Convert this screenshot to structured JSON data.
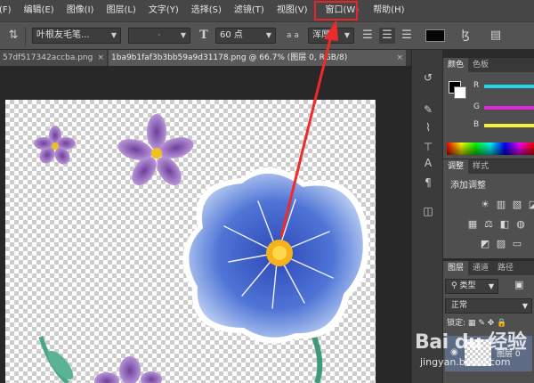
{
  "menubar": {
    "items": [
      "(F)",
      "编辑(E)",
      "图像(I)",
      "图层(L)",
      "文字(Y)",
      "选择(S)",
      "滤镜(T)",
      "视图(V)",
      "窗口(W)",
      "帮助(H)"
    ],
    "highlighted": "窗口(W)",
    "highlight_color": "#e8232a"
  },
  "options": {
    "font_family": "叶根友毛笔...",
    "font_style": "-",
    "font_size": "60 点",
    "aa_label": "a a",
    "aa_mode": "浑厚",
    "color": "#050505"
  },
  "tabs": [
    {
      "label": "57df517342accba.png",
      "close": "×"
    },
    {
      "label": "1ba9b1faf3b3bb59a9d31178.png @ 66.7% (图层 0, RGB/8)",
      "close": "×"
    }
  ],
  "color_panel": {
    "tabs": [
      "颜色",
      "色板"
    ],
    "channels": [
      {
        "label": "R",
        "color": "#22d6e6"
      },
      {
        "label": "G",
        "color": "#e028e0"
      },
      {
        "label": "B",
        "color": "#f2f23a"
      }
    ]
  },
  "adjust_panel": {
    "tabs": [
      "调整",
      "样式"
    ],
    "title": "添加调整"
  },
  "layers_panel": {
    "tabs": [
      "图层",
      "通道",
      "路径"
    ],
    "filter": "类型",
    "blend_mode": "正常",
    "lock_label": "锁定:",
    "layer_name": "图层 0"
  },
  "watermark": {
    "logo": "Bai du 经验",
    "url": "jingyan.baidu.com"
  }
}
